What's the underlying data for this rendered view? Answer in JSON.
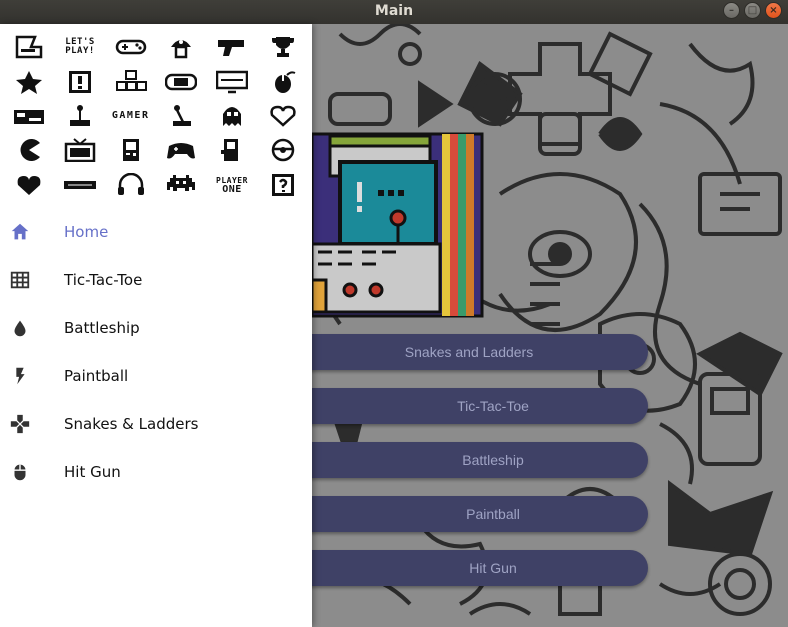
{
  "window": {
    "title": "Main",
    "buttons": [
      "minimize",
      "maximize",
      "close"
    ]
  },
  "drawer": {
    "icon_grid": [
      {
        "icon": "arcade-cabinet-icon"
      },
      {
        "icon": "lets-play-text",
        "text_line1": "LET'S",
        "text_line2": "PLAY!"
      },
      {
        "icon": "gamepad-icon"
      },
      {
        "icon": "mushroom-icon"
      },
      {
        "icon": "zapper-gun-icon"
      },
      {
        "icon": "trophy-icon"
      },
      {
        "icon": "star-icon"
      },
      {
        "icon": "exclamation-block-icon"
      },
      {
        "icon": "keyboard-keys-icon"
      },
      {
        "icon": "handheld-console-icon"
      },
      {
        "icon": "monitor-icon"
      },
      {
        "icon": "mouse-icon"
      },
      {
        "icon": "console-icon"
      },
      {
        "icon": "joystick-icon"
      },
      {
        "icon": "gamer-text",
        "text_line1": "GAMER",
        "text_line2": ""
      },
      {
        "icon": "arcade-stick-icon"
      },
      {
        "icon": "ghost-icon"
      },
      {
        "icon": "heart-outline-icon"
      },
      {
        "icon": "pacman-icon"
      },
      {
        "icon": "retro-tv-icon"
      },
      {
        "icon": "gameboy-icon"
      },
      {
        "icon": "gamepad-alt-icon"
      },
      {
        "icon": "arcade-machine-icon"
      },
      {
        "icon": "steering-wheel-icon"
      },
      {
        "icon": "heart-icon"
      },
      {
        "icon": "vhs-console-icon"
      },
      {
        "icon": "headphones-icon"
      },
      {
        "icon": "space-invader-icon"
      },
      {
        "icon": "player-one-text",
        "text_line1": "PLAYER",
        "text_line2": "ONE"
      },
      {
        "icon": "question-block-icon"
      }
    ],
    "nav": [
      {
        "label": "Home",
        "icon": "home-icon",
        "active": true
      },
      {
        "label": "Tic-Tac-Toe",
        "icon": "grid-icon",
        "active": false
      },
      {
        "label": "Battleship",
        "icon": "water-drop-icon",
        "active": false
      },
      {
        "label": "Paintball",
        "icon": "flash-icon",
        "active": false
      },
      {
        "label": "Snakes & Ladders",
        "icon": "dpad-icon",
        "active": false
      },
      {
        "label": "Hit Gun",
        "icon": "mouse-icon",
        "active": false
      }
    ]
  },
  "main": {
    "buttons": [
      {
        "label": "Snakes and Ladders"
      },
      {
        "label": "Tic-Tac-Toe"
      },
      {
        "label": "Battleship"
      },
      {
        "label": "Paintball"
      },
      {
        "label": "Hit Gun"
      }
    ]
  },
  "colors": {
    "accent": "#6670c8",
    "button_bg": "#3f4166",
    "button_text": "#9fa3c4",
    "drawer_bg": "#ffffff"
  }
}
